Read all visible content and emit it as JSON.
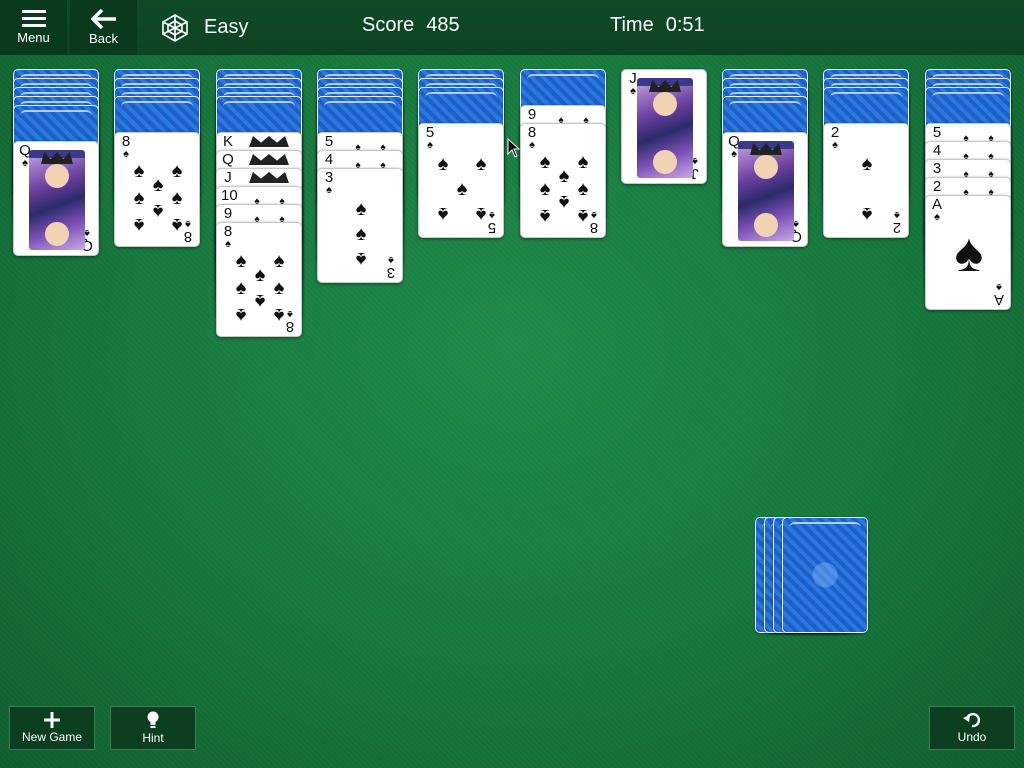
{
  "toolbar": {
    "menu_label": "Menu",
    "back_label": "Back",
    "difficulty": "Easy",
    "score_label": "Score",
    "score_value": "485",
    "time_label": "Time",
    "time_value": "0:51"
  },
  "tableau": [
    {
      "hidden": 5,
      "face_up": [
        {
          "rank": "Q",
          "suit": "♠"
        }
      ]
    },
    {
      "hidden": 4,
      "face_up": [
        {
          "rank": "8",
          "suit": "♠"
        }
      ]
    },
    {
      "hidden": 4,
      "face_up": [
        {
          "rank": "K",
          "suit": "♠"
        },
        {
          "rank": "Q",
          "suit": "♠"
        },
        {
          "rank": "J",
          "suit": "♠"
        },
        {
          "rank": "10",
          "suit": "♠"
        },
        {
          "rank": "9",
          "suit": "♠"
        },
        {
          "rank": "8",
          "suit": "♠"
        }
      ]
    },
    {
      "hidden": 4,
      "face_up": [
        {
          "rank": "5",
          "suit": "♠"
        },
        {
          "rank": "4",
          "suit": "♠"
        },
        {
          "rank": "3",
          "suit": "♠"
        }
      ]
    },
    {
      "hidden": 3,
      "face_up": [
        {
          "rank": "5",
          "suit": "♠"
        }
      ]
    },
    {
      "hidden": 1,
      "face_up": [
        {
          "rank": "9",
          "suit": "♠"
        },
        {
          "rank": "8",
          "suit": "♠"
        }
      ]
    },
    {
      "hidden": 0,
      "face_up": [
        {
          "rank": "J",
          "suit": "♠"
        }
      ]
    },
    {
      "hidden": 4,
      "face_up": [
        {
          "rank": "Q",
          "suit": "♠"
        }
      ]
    },
    {
      "hidden": 3,
      "face_up": [
        {
          "rank": "2",
          "suit": "♠"
        }
      ]
    },
    {
      "hidden": 3,
      "face_up": [
        {
          "rank": "5",
          "suit": "♠"
        },
        {
          "rank": "4",
          "suit": "♠"
        },
        {
          "rank": "3",
          "suit": "♠"
        },
        {
          "rank": "2",
          "suit": "♠"
        },
        {
          "rank": "A",
          "suit": "♠"
        }
      ]
    }
  ],
  "stock": {
    "remaining_deals": 4
  },
  "bottom": {
    "new_game_label": "New Game",
    "hint_label": "Hint",
    "undo_label": "Undo"
  },
  "icons": {
    "menu": "hamburger-icon",
    "back": "arrow-left-icon",
    "difficulty": "spider-web-icon",
    "new_game": "plus-icon",
    "hint": "lightbulb-icon",
    "undo": "undo-icon"
  },
  "colors": {
    "felt": "#16773c",
    "toolbar": "#0d4323",
    "card_back": "#2a78e0"
  }
}
